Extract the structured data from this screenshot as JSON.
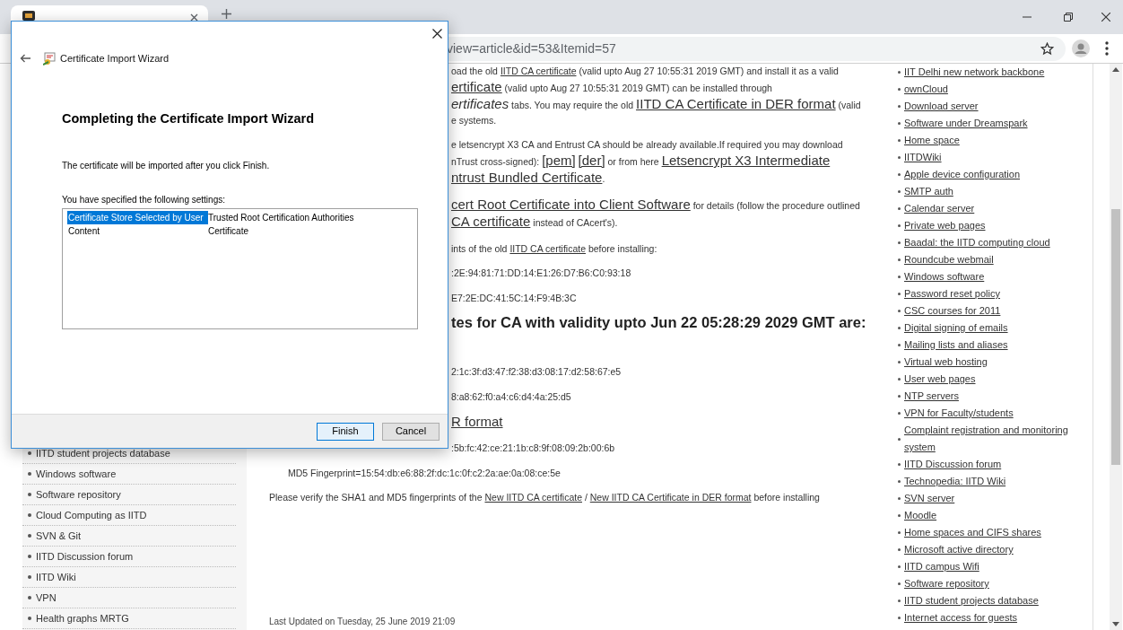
{
  "browser": {
    "url": "view=article&id=53&Itemid=57"
  },
  "left_sidebar": {
    "items": [
      "IITD student projects database",
      "Windows software",
      "Software repository",
      "Cloud Computing as IITD",
      "SVN & Git",
      "IITD Discussion forum",
      "IITD Wiki",
      "VPN",
      "Health graphs MRTG"
    ]
  },
  "article": {
    "paragraphs": [
      {
        "kind": "clipped",
        "lines": [
          [
            {
              "kind": "text",
              "text": "oad the old "
            },
            {
              "kind": "link",
              "text": "IITD CA certificate"
            },
            {
              "kind": "text",
              "text": " (valid upto Aug 27 10:55:31 2019 GMT) and install it as a valid"
            }
          ],
          [
            {
              "kind": "biglink",
              "text": "ertificate"
            },
            {
              "kind": "text",
              "text": " (valid upto Aug 27 10:55:31 2019 GMT) can be installed through"
            }
          ],
          [
            {
              "kind": "bigitalic",
              "text": "ertificates"
            },
            {
              "kind": "text",
              "text": " tabs. You may require the old "
            },
            {
              "kind": "biglink",
              "text": "IITD CA Certificate in DER format"
            },
            {
              "kind": "text",
              "text": " (valid"
            }
          ],
          [
            {
              "kind": "text",
              "text": "e systems."
            }
          ]
        ]
      },
      {
        "kind": "clipped",
        "lines": [
          [
            {
              "kind": "text",
              "text": "e letsencrypt X3 CA and Entrust CA should be already available.If required you may download"
            }
          ],
          [
            {
              "kind": "text",
              "text": "nTrust cross-signed): "
            },
            {
              "kind": "biglink",
              "text": "[pem]"
            },
            {
              "kind": "biglink",
              "text": "[der]"
            },
            {
              "kind": "text",
              "text": " or from here "
            },
            {
              "kind": "biglink",
              "text": "Letsencrypt X3 Intermediate"
            }
          ],
          [
            {
              "kind": "biglink",
              "text": "ntrust Bundled Certificate"
            },
            {
              "kind": "text",
              "text": "."
            }
          ]
        ]
      },
      {
        "kind": "clipped",
        "lines": [
          [
            {
              "kind": "biglink",
              "text": "cert Root Certificate into Client Software"
            },
            {
              "kind": "text",
              "text": " for details (follow the procedure outlined"
            }
          ],
          [
            {
              "kind": "biglink",
              "text": "CA certificate"
            },
            {
              "kind": "text",
              "text": " instead of CAcert's)."
            }
          ]
        ]
      },
      {
        "kind": "clipped",
        "lines": [
          [
            {
              "kind": "text",
              "text": "ints of the old "
            },
            {
              "kind": "link",
              "text": "IITD CA certificate"
            },
            {
              "kind": "text",
              "text": " before installing:"
            }
          ]
        ]
      },
      {
        "kind": "clipped",
        "lines": [
          [
            {
              "kind": "text",
              "text": ":2E:94:81:71:DD:14:E1:26:D7:B6:C0:93:18"
            }
          ]
        ]
      },
      {
        "kind": "clipped",
        "lines": [
          [
            {
              "kind": "text",
              "text": "E7:2E:DC:41:5C:14:F9:4B:3C"
            }
          ]
        ]
      },
      {
        "kind": "heading",
        "lines": [
          [
            {
              "kind": "text",
              "text": "tes for CA with validity upto Jun 22 05:28:29 2029 GMT are:"
            }
          ]
        ]
      },
      {
        "kind": "clipped",
        "lines": [
          [
            {
              "kind": "text",
              "text": "2:1c:3f:d3:47:f2:38:d3:08:17:d2:58:67:e5"
            }
          ]
        ]
      },
      {
        "kind": "clipped",
        "lines": [
          [
            {
              "kind": "text",
              "text": "8:a8:62:f0:a4:c6:d4:4a:25:d5"
            }
          ]
        ]
      },
      {
        "kind": "clipped",
        "lines": [
          [
            {
              "kind": "biglink",
              "text": "R format"
            }
          ]
        ]
      },
      {
        "kind": "clipped",
        "lines": [
          [
            {
              "kind": "text",
              "text": ":5b:fc:42:ce:21:1b:c8:9f:08:09:2b:00:6b"
            }
          ]
        ]
      },
      {
        "kind": "inset",
        "lines": [
          [
            {
              "kind": "text",
              "text": "MD5  Fingerprint=15:54:db:e6:88:2f:dc:1c:0f:c2:2a:ae:0a:08:ce:5e"
            }
          ]
        ]
      },
      {
        "kind": "full",
        "lines": [
          [
            {
              "kind": "text",
              "text": "Please verify the SHA1 and MD5 fingerprints of the "
            },
            {
              "kind": "link",
              "text": "New IITD CA certificate"
            },
            {
              "kind": "text",
              "text": " / "
            },
            {
              "kind": "link",
              "text": "New IITD CA Certificate in DER format"
            },
            {
              "kind": "text",
              "text": " before installing"
            }
          ]
        ]
      },
      {
        "kind": "footer",
        "lines": [
          [
            {
              "kind": "text",
              "text": "Last Updated on Tuesday, 25 June 2019 21:09"
            }
          ]
        ]
      }
    ]
  },
  "right_sidebar": {
    "items": [
      "IIT Delhi new network backbone",
      "ownCloud",
      "Download server",
      "Software under Dreamspark",
      "Home space",
      "IITDWiki",
      "Apple device configuration",
      "SMTP auth",
      "Calendar server",
      "Private web pages",
      "Baadal: the IITD computing cloud",
      "Roundcube webmail",
      "Windows software",
      "Password reset policy",
      "CSC courses for 2011",
      "Digital signing of emails",
      "Mailing lists and aliases",
      "Virtual web hosting",
      "User web pages",
      "NTP servers",
      "VPN for Faculty/students",
      "Complaint registration and monitoring system",
      "IITD Discussion forum",
      "Technopedia: IITD Wiki",
      "SVN server",
      "Moodle",
      "Home spaces and CIFS shares",
      "Microsoft active directory",
      "IITD campus Wifi",
      "Software repository",
      "IITD student projects database",
      "Internet access for guests"
    ]
  },
  "dialog": {
    "title": "Certificate Import Wizard",
    "heading": "Completing the Certificate Import Wizard",
    "message": "The certificate will be imported after you click Finish.",
    "settings_label": "You have specified the following settings:",
    "settings": [
      {
        "cells": [
          "Certificate Store Selected by User",
          "Trusted Root Certification Authorities"
        ],
        "selected": true
      },
      {
        "cells": [
          "Content",
          "Certificate"
        ],
        "selected": false
      }
    ],
    "buttons": [
      {
        "label": "Finish",
        "default": true
      },
      {
        "label": "Cancel",
        "default": false
      }
    ]
  }
}
